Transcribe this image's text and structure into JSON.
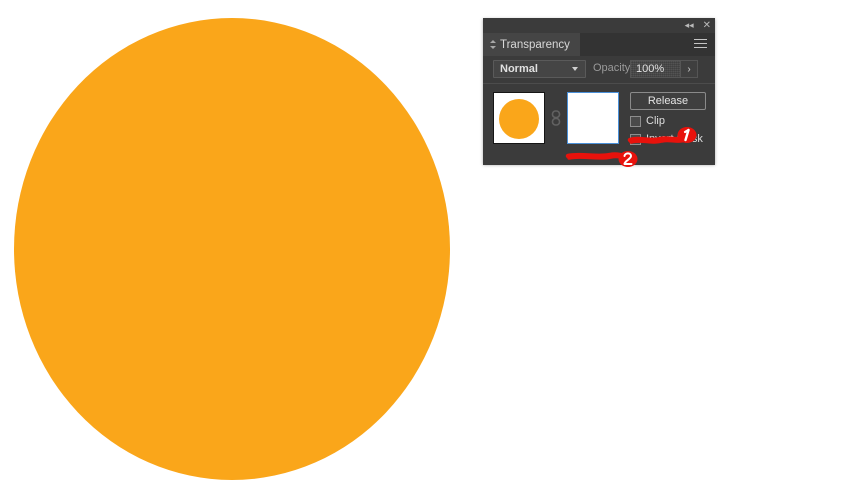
{
  "canvas": {
    "shape_name": "orange-ellipse",
    "fill_color": "#faa61a"
  },
  "panel": {
    "titlebar": {
      "collapse_label": "◂◂",
      "close_label": "✕"
    },
    "tab": {
      "label": "Transparency"
    },
    "menu_icon": "hamburger-menu-icon",
    "controls": {
      "blend_mode": "Normal",
      "opacity_label": "Opacity:",
      "opacity_value": "100%",
      "opacity_arrow": "›"
    },
    "body": {
      "release_label": "Release",
      "clip_label": "Clip",
      "clip_checked": false,
      "invert_mask_label": "Invert Mask",
      "invert_mask_checked": false,
      "art_thumbnail": "orange-circle-thumbnail",
      "mask_thumbnail": "white-mask-thumbnail",
      "link_icon": "chain-link-icon"
    },
    "colors": {
      "panel_bg": "#3b3b3b",
      "tab_bg": "#454545",
      "tabstrip_bg": "#333333",
      "mask_selection_border": "#4a90d9",
      "text": "#dedede"
    }
  },
  "annotations": {
    "accent_color": "#e8120c",
    "markers": [
      {
        "label": "1",
        "target": "clip-checkbox"
      },
      {
        "label": "2",
        "target": "mask-thumbnail-underline"
      }
    ]
  }
}
